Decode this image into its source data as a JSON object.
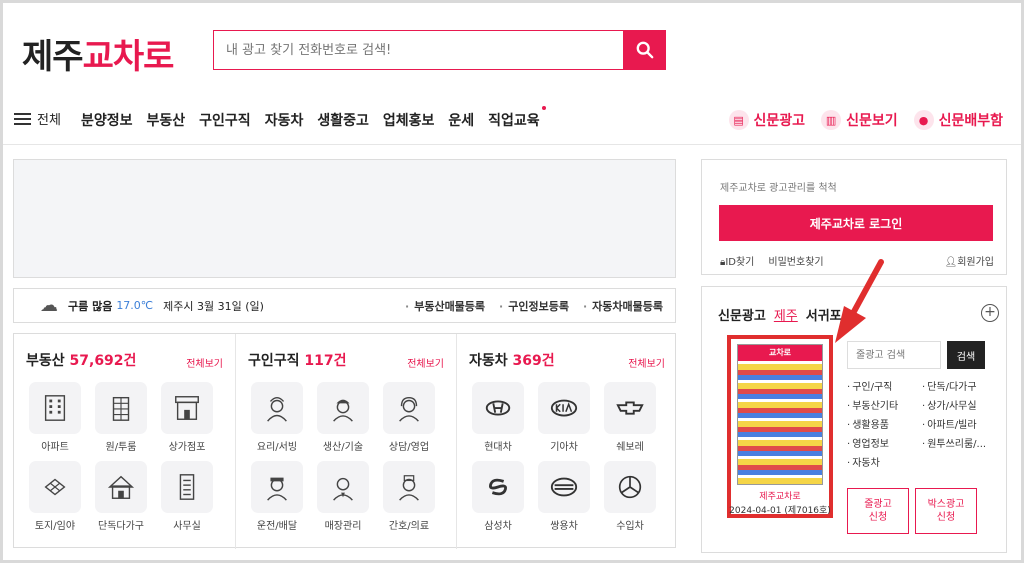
{
  "logo": {
    "part1": "제주",
    "part2": "교차로"
  },
  "search": {
    "placeholder": "내 광고 찾기 전화번호로 검색!"
  },
  "nav": {
    "all_label": "전체",
    "items": [
      "분양정보",
      "부동산",
      "구인구직",
      "자동차",
      "생활중고",
      "업체홍보",
      "운세",
      "직업교육"
    ],
    "right": [
      "신문광고",
      "신문보기",
      "신문배부함"
    ]
  },
  "weather": {
    "condition": "구름 많음",
    "temp": "17.0℃",
    "location_date": "제주시 3월 31일 (일)",
    "links": [
      "부동산매물등록",
      "구인정보등록",
      "자동차매물등록"
    ]
  },
  "categories": [
    {
      "title": "부동산",
      "count": "57,692",
      "unit": "건",
      "all": "전체보기",
      "items": [
        "아파트",
        "원/투룸",
        "상가점포",
        "토지/임야",
        "단독다가구",
        "사무실"
      ]
    },
    {
      "title": "구인구직",
      "count": "117",
      "unit": "건",
      "all": "전체보기",
      "items": [
        "요리/서빙",
        "생산/기술",
        "상담/영업",
        "운전/배달",
        "매장관리",
        "간호/의료"
      ]
    },
    {
      "title": "자동차",
      "count": "369",
      "unit": "건",
      "all": "전체보기",
      "items": [
        "현대차",
        "기아차",
        "쉐보레",
        "삼성차",
        "쌍용차",
        "수입차"
      ]
    }
  ],
  "login": {
    "message": "제주교차로 광고관리를 척척",
    "button": "제주교차로 로그인",
    "find_id": "ID찾기",
    "find_pw": "비밀번호찾기",
    "signup": "회원가입"
  },
  "paper": {
    "tab_title": "신문광고",
    "tab_jeju": "제주",
    "tab_seogwipo": "서귀포",
    "thumb_masthead": "교차로",
    "thumb_title": "제주교차로",
    "thumb_date": "2024-04-01 (제7016호)",
    "search_placeholder": "줄광고 검색",
    "search_button": "검색",
    "classifieds": [
      "구인/구직",
      "단독/다가구",
      "부동산기타",
      "상가/사무실",
      "생활용품",
      "아파트/빌라",
      "영업정보",
      "원투쓰리룸/...",
      "자동차"
    ],
    "btn_line_ad": "줄광고\n신청",
    "btn_box_ad": "박스광고\n신청"
  },
  "colors": {
    "accent": "#e8194f",
    "annotation": "#e02e2e",
    "temp": "#3c7fd8"
  }
}
